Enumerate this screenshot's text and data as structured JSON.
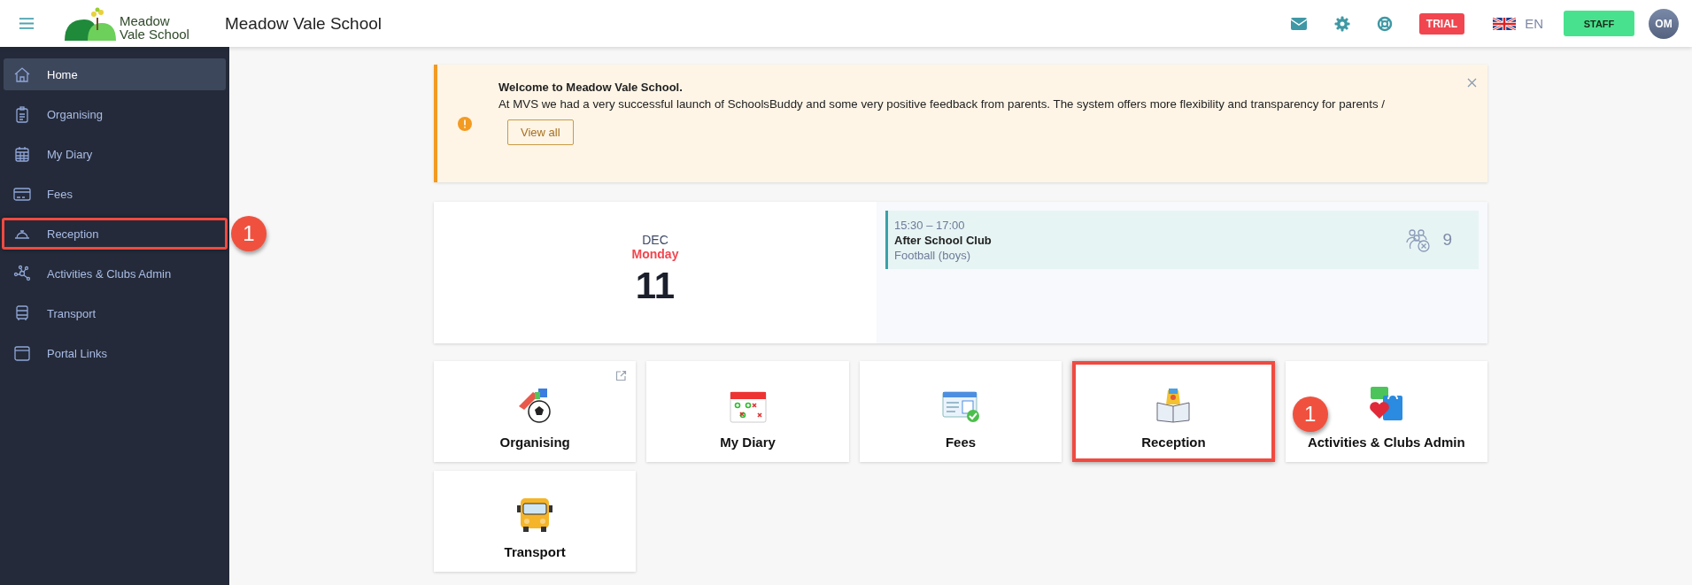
{
  "header": {
    "logo_line_1": "Meadow",
    "logo_line_2": "Vale School",
    "title": "Meadow Vale School",
    "trial_badge": "TRIAL",
    "language": "EN",
    "role_button": "STAFF",
    "avatar": "OM"
  },
  "sidebar": {
    "items": [
      {
        "label": "Home",
        "selected": true,
        "highlighted": false
      },
      {
        "label": "Organising",
        "selected": false,
        "highlighted": false
      },
      {
        "label": "My Diary",
        "selected": false,
        "highlighted": false
      },
      {
        "label": "Fees",
        "selected": false,
        "highlighted": false
      },
      {
        "label": "Reception",
        "selected": false,
        "highlighted": true,
        "callout": "1"
      },
      {
        "label": "Activities & Clubs Admin",
        "selected": false,
        "highlighted": false
      },
      {
        "label": "Transport",
        "selected": false,
        "highlighted": false
      },
      {
        "label": "Portal Links",
        "selected": false,
        "highlighted": false
      }
    ]
  },
  "notice": {
    "title": "Welcome to Meadow Vale School.",
    "text": "At MVS we had a very successful launch of SchoolsBuddy and some very positive feedback from parents. The system offers more flexibility and transparency for parents /",
    "button": "View all"
  },
  "calendar": {
    "month": "DEC",
    "weekday": "Monday",
    "day": "11",
    "events": [
      {
        "time": "15:30 – 17:00",
        "title": "After School Club",
        "subtitle": "Football (boys)",
        "count": "9"
      }
    ]
  },
  "tiles": [
    {
      "label": "Organising",
      "external": true,
      "highlighted": false
    },
    {
      "label": "My Diary",
      "external": false,
      "highlighted": false
    },
    {
      "label": "Fees",
      "external": false,
      "highlighted": false
    },
    {
      "label": "Reception",
      "external": false,
      "highlighted": true,
      "callout": "1"
    },
    {
      "label": "Activities & Clubs Admin",
      "external": false,
      "highlighted": false
    },
    {
      "label": "Transport",
      "external": false,
      "highlighted": false
    }
  ]
}
